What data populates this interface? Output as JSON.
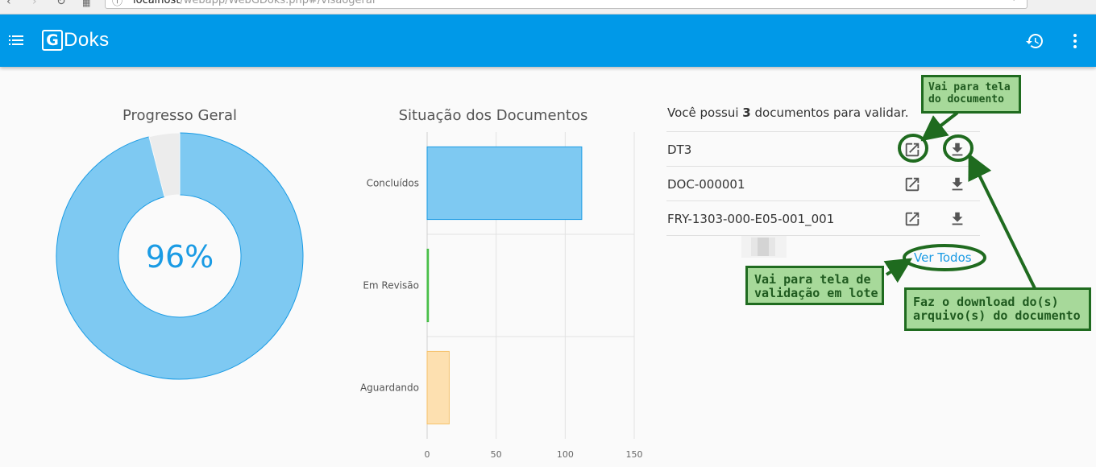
{
  "browser": {
    "url_host": "localhost",
    "url_path": "/webapp/WebGDoks.php#/visaogeral"
  },
  "appbar": {
    "logo_g": "G",
    "logo_text": "Doks"
  },
  "progress": {
    "title": "Progresso Geral",
    "percent_label": "96%",
    "percent_value": 96
  },
  "status_chart": {
    "title": "Situação dos Documentos"
  },
  "chart_data": {
    "type": "bar",
    "orientation": "horizontal",
    "title": "Situação dos Documentos",
    "categories": [
      "Concluídos",
      "Em Revisão",
      "Aguardando"
    ],
    "values": [
      112,
      1,
      16
    ],
    "colors": [
      "#7ec9f2",
      "#5cc85c",
      "#fde0b0"
    ],
    "border_colors": [
      "#1a9be4",
      "#3cb93c",
      "#f5c26b"
    ],
    "xlim": [
      0,
      150
    ],
    "xticks": [
      "0",
      "50",
      "100",
      "150"
    ],
    "grid": true
  },
  "docs": {
    "intro_prefix": "Você possui ",
    "count": "3",
    "intro_suffix": " documentos para validar.",
    "items": [
      {
        "name": "DT3"
      },
      {
        "name": "DOC-000001"
      },
      {
        "name": "FRY-1303-000-E05-001_001"
      }
    ],
    "see_all": "Ver Todos"
  },
  "annotations": {
    "open_doc": "Vai para tela\ndo documento",
    "batch": "Vai para tela de\nvalidação em lote",
    "download": "Faz o download do(s)\narquivo(s) do documento"
  },
  "colors": {
    "appbar": "#0099e8",
    "accent": "#1a9be4",
    "donut_fill": "#7ec9f2",
    "annotation_green": "#1f6b1f"
  }
}
